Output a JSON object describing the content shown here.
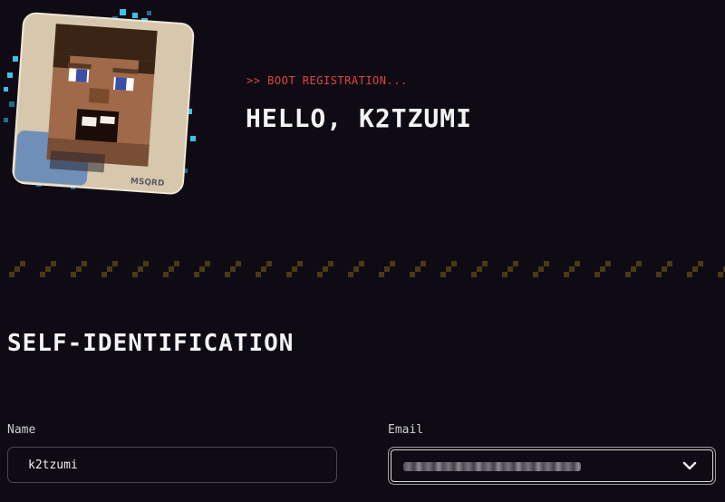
{
  "header": {
    "boot_line": ">> BOOT REGISTRATION...",
    "greeting": "HELLO, K2TZUMI",
    "avatar_badge": "MSQRD"
  },
  "section": {
    "title": "SELF-IDENTIFICATION"
  },
  "form": {
    "name_label": "Name",
    "name_value": "k2tzumi",
    "email_label": "Email",
    "email_value_obscured": true
  },
  "colors": {
    "background": "#0f0b14",
    "accent_red": "#e0453d",
    "pixel_cyan": "#3cc3e6",
    "divider_gold": "#4a3a14"
  },
  "icons": {
    "avatar": "minecraft-steve-head",
    "select_chevron": "chevron-down-icon"
  }
}
